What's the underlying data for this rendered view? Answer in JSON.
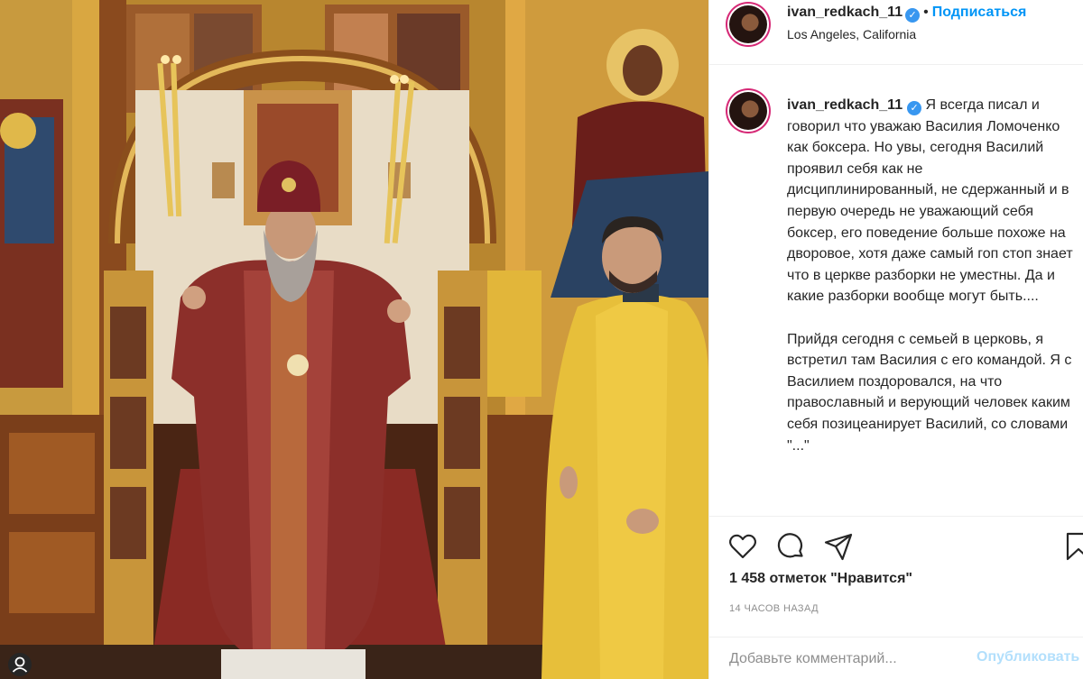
{
  "post": {
    "username": "ivan_redkach_11",
    "follow_label": "Подписаться",
    "location": "Los Angeles, California"
  },
  "caption": {
    "username": "ivan_redkach_11",
    "paragraph1": "Я всегда писал и говорил что уважаю Василия Ломоченко как боксера. Но увы, сегодня Василий проявил себя как не дисциплинированный, не сдержанный и в первую очередь не уважающий себя боксер, его поведение больше похоже на дворовое, хотя даже самый гоп стоп знает что в церкве разборки не уместны. Да и какие разборки вообще могут быть....",
    "paragraph2": "Прийдя сегодня с семьей в церковь, я встретил там Василия с его командой. Я с Василием поздоровался, на что православный и верующий человек каким себя позицеанирует Василий, со словами \"...\""
  },
  "stats": {
    "likes": "1 458 отметок \"Нравится\"",
    "time_ago": "14 часов назад"
  },
  "comment": {
    "placeholder": "Добавьте комментарий...",
    "publish_label": "Опубликовать"
  },
  "colors": {
    "accent": "#0095f6",
    "verified": "#3897f0",
    "text": "#262626",
    "muted": "#8e8e8e",
    "publish_disabled": "#b2dffc"
  },
  "icons": [
    "heart-icon",
    "comment-icon",
    "share-icon",
    "bookmark-icon",
    "verified-badge-icon",
    "user-tag-icon"
  ]
}
